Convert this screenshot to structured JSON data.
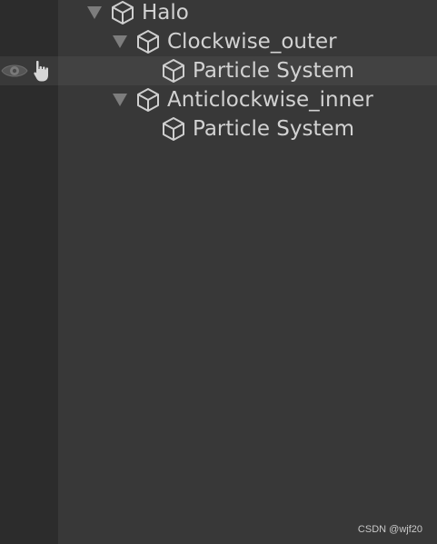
{
  "hierarchy": {
    "items": [
      {
        "label": "Halo",
        "icon": "gameobject-cube-icon",
        "expanded": true
      },
      {
        "label": "Clockwise_outer",
        "icon": "gameobject-cube-icon",
        "expanded": true
      },
      {
        "label": "Particle System",
        "icon": "gameobject-cube-icon",
        "hovered": true
      },
      {
        "label": "Anticlockwise_inner",
        "icon": "gameobject-cube-icon",
        "expanded": true
      },
      {
        "label": "Particle System",
        "icon": "gameobject-cube-icon"
      }
    ],
    "hover_icons": [
      "visibility-eye-icon",
      "pickable-hand-icon"
    ]
  },
  "watermark": "CSDN @wjf20",
  "colors": {
    "panel": "#383838",
    "gutter": "#2c2c2c",
    "hover_row": "#424242",
    "text": "#d2d2d2",
    "icon": "#cfcfcf",
    "arrow": "#7d7d7d"
  }
}
